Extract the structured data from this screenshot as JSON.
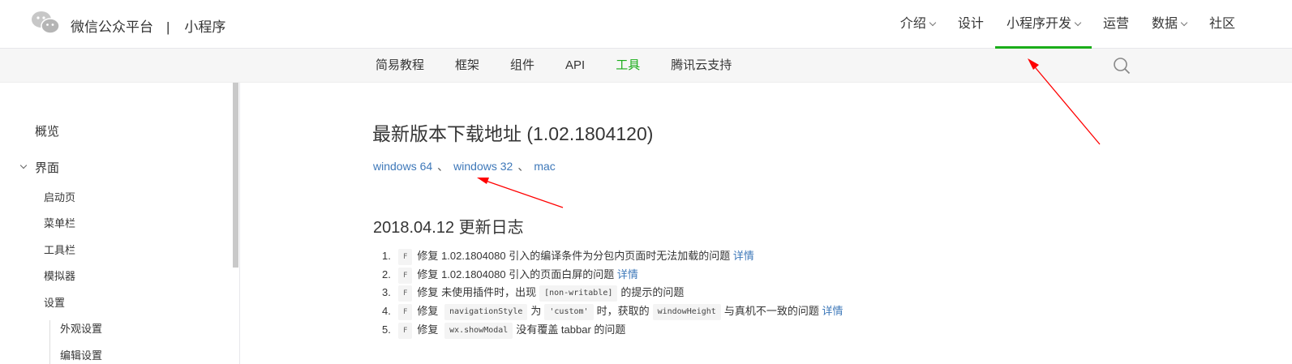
{
  "header": {
    "brand": "微信公众平台",
    "separator": "|",
    "product": "小程序",
    "nav": [
      {
        "label": "介绍",
        "dropdown": true
      },
      {
        "label": "设计",
        "dropdown": false
      },
      {
        "label": "小程序开发",
        "dropdown": true,
        "active": true
      },
      {
        "label": "运营",
        "dropdown": false
      },
      {
        "label": "数据",
        "dropdown": true
      },
      {
        "label": "社区",
        "dropdown": false
      }
    ]
  },
  "subnav": {
    "items": [
      "简易教程",
      "框架",
      "组件",
      "API",
      "工具",
      "腾讯云支持"
    ],
    "active": "工具"
  },
  "sidebar": {
    "items": [
      "概览",
      "界面",
      "启动页",
      "菜单栏",
      "工具栏",
      "模拟器",
      "设置",
      "外观设置",
      "编辑设置"
    ]
  },
  "main": {
    "title": "最新版本下载地址 (1.02.1804120)",
    "links": [
      "windows 64",
      "windows 32",
      "mac"
    ],
    "link_separator": "、",
    "changelog_title": "2018.04.12 更新日志",
    "tag": "F",
    "changelog": [
      {
        "num": "1.",
        "fix": "修复",
        "text": "1.02.1804080 引入的编译条件为分包内页面时无法加载的问题",
        "detail": "详情"
      },
      {
        "num": "2.",
        "fix": "修复",
        "text": "1.02.1804080 引入的页面白屏的问题",
        "detail": "详情"
      },
      {
        "num": "3.",
        "fix": "修复",
        "text_a": "未使用插件时，出现",
        "code_a": "[non-writable]",
        "text_b": "的提示的问题"
      },
      {
        "num": "4.",
        "fix": "修复",
        "code_a": "navigationStyle",
        "text_a": "为",
        "code_b": "'custom'",
        "text_b": "时，获取的",
        "code_c": "windowHeight",
        "text_c": "与真机不一致的问题",
        "detail": "详情"
      },
      {
        "num": "5.",
        "fix": "修复",
        "code_a": "wx.showModal",
        "text_a": "没有覆盖 tabbar 的问题"
      }
    ]
  },
  "colors": {
    "accent": "#1aad19",
    "link": "#3e78b9",
    "annotation_arrow": "#ff0000"
  },
  "icons": {
    "logo": "wechat-logo-icon",
    "search": "search-icon"
  }
}
